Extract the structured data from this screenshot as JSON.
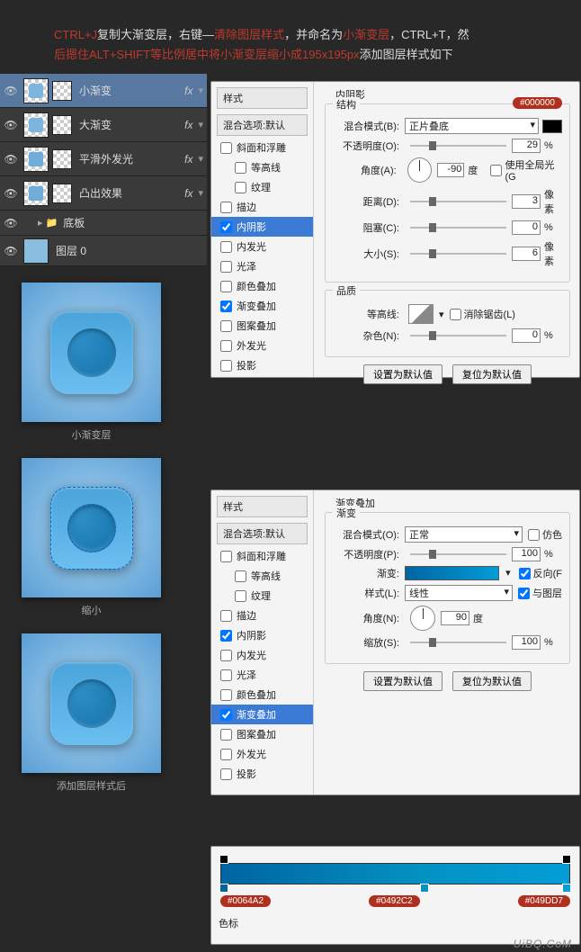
{
  "instruction": {
    "s1": "CTRL+J",
    "s2": "复制大渐变层，右键—",
    "s3": "清除图层样式",
    "s4": "，并命名为",
    "s5": "小渐变层",
    "s6": "，CTRL+T，然",
    "s7": "后摁住ALT+SHIFT等比例居中将小渐变层缩小成195x195px",
    "s8": "添加图层样式如下"
  },
  "layers": {
    "l1": "小渐变",
    "l2": "大渐变",
    "l3": "平滑外发光",
    "l4": "凸出效果",
    "folder": "底板",
    "l5": "图层 0",
    "fx": "fx"
  },
  "previews": {
    "p1": "小渐变层",
    "p2": "缩小",
    "p3": "添加图层样式后"
  },
  "style_list": {
    "hdr": "样式",
    "blend": "混合选项:默认",
    "bevel": "斜面和浮雕",
    "contour": "等高线",
    "texture": "纹理",
    "stroke": "描边",
    "inner_shadow": "内阴影",
    "inner_glow": "内发光",
    "satin": "光泽",
    "color_overlay": "颜色叠加",
    "grad_overlay": "渐变叠加",
    "pattern_overlay": "图案叠加",
    "outer_glow": "外发光",
    "drop_shadow": "投影"
  },
  "inner_shadow": {
    "title": "内阴影",
    "struct": "结构",
    "badge": "#000000",
    "blend_label": "混合模式(B):",
    "blend_val": "正片叠底",
    "opac_label": "不透明度(O):",
    "opac_val": "29",
    "pct": "%",
    "angle_label": "角度(A):",
    "angle_val": "-90",
    "deg": "度",
    "global": "使用全局光(G",
    "dist_label": "距离(D):",
    "dist_val": "3",
    "px": "像素",
    "choke_label": "阻塞(C):",
    "choke_val": "0",
    "size_label": "大小(S):",
    "size_val": "6",
    "quality": "品质",
    "contour_label": "等高线:",
    "anti": "消除锯齿(L)",
    "noise_label": "杂色(N):",
    "noise_val": "0",
    "btn_default": "设置为默认值",
    "btn_reset": "复位为默认值"
  },
  "grad_overlay": {
    "title": "渐变叠加",
    "grad": "渐变",
    "blend_label": "混合模式(O):",
    "blend_val": "正常",
    "dither": "仿色",
    "opac_label": "不透明度(P):",
    "opac_val": "100",
    "pct": "%",
    "grad_label": "渐变:",
    "reverse": "反向(F",
    "style_label": "样式(L):",
    "style_val": "线性",
    "align": "与图层",
    "angle_label": "角度(N):",
    "angle_val": "90",
    "deg": "度",
    "scale_label": "缩放(S):",
    "scale_val": "100",
    "btn_default": "设置为默认值",
    "btn_reset": "复位为默认值"
  },
  "gradient_editor": {
    "title": "色标",
    "c1": "#0064A2",
    "c2": "#0492C2",
    "c3": "#049DD7"
  },
  "watermark": "UiBQ.CoM"
}
